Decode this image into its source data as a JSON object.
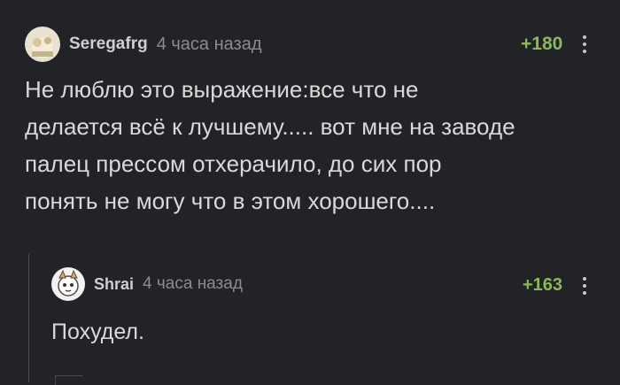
{
  "comments": [
    {
      "author": "Seregafrg",
      "time": "4 часа назад",
      "rating": "+180",
      "lines": [
        "Не люблю это выражение:все что не",
        "делается всё к лучшему..... вот мне на заводе",
        "палец прессом отхерачило, до сих пор",
        "понять не могу что в этом хорошего...."
      ]
    },
    {
      "author": "Shrai",
      "time": "4 часа назад",
      "rating": "+163",
      "lines": [
        "Похудел."
      ]
    }
  ],
  "icons": {
    "more": "more-vertical-icon"
  },
  "colors": {
    "background": "#222326",
    "rating": "#8ab85a",
    "meta": "#8c8c8c"
  }
}
